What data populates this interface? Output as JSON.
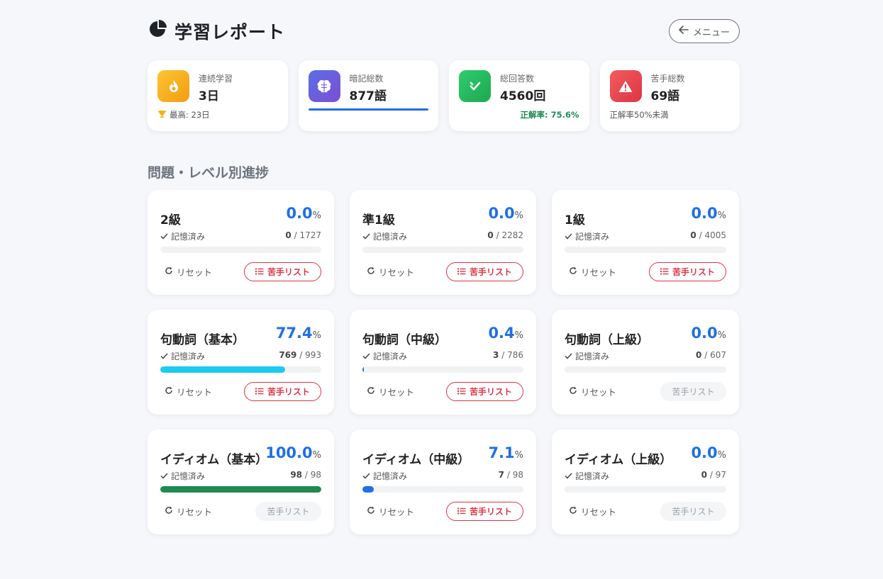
{
  "header": {
    "title": "学習レポート",
    "menu_label": "メニュー"
  },
  "stats": [
    {
      "label": "連続学習",
      "value": "3日",
      "sub": "最高: 23日",
      "icon": "flame-icon",
      "color": "#f7b322"
    },
    {
      "label": "暗記総数",
      "value": "877語",
      "icon": "brain-icon",
      "color": "#6f55d6"
    },
    {
      "label": "総回答数",
      "value": "4560回",
      "sub": "正解率: 75.6%",
      "icon": "check-icon",
      "color": "#22b35e"
    },
    {
      "label": "苦手総数",
      "value": "69語",
      "sub": "正解率50%未満",
      "icon": "warning-icon",
      "color": "#e84848"
    }
  ],
  "section_title": "問題・レベル別進捗",
  "common": {
    "memorized_label": "記憶済み",
    "reset_label": "リセット",
    "weak_label": "苦手リスト",
    "percent_sign": "%"
  },
  "levels": [
    {
      "name": "2級",
      "percent": "0.0",
      "done": "0",
      "total": "/ 1727",
      "progress": 0,
      "bar_color": "#1f6fe5",
      "weak_active": true
    },
    {
      "name": "準1級",
      "percent": "0.0",
      "done": "0",
      "total": "/ 2282",
      "progress": 0,
      "bar_color": "#1f6fe5",
      "weak_active": true
    },
    {
      "name": "1級",
      "percent": "0.0",
      "done": "0",
      "total": "/ 4005",
      "progress": 0,
      "bar_color": "#1f6fe5",
      "weak_active": true
    },
    {
      "name": "句動詞（基本）",
      "percent": "77.4",
      "done": "769",
      "total": "/ 993",
      "progress": 0.774,
      "bar_color": "#1ccaf0",
      "weak_active": true
    },
    {
      "name": "句動詞（中級）",
      "percent": "0.4",
      "done": "3",
      "total": "/ 786",
      "progress": 0.004,
      "bar_color": "#1f6fe5",
      "weak_active": true
    },
    {
      "name": "句動詞（上級）",
      "percent": "0.0",
      "done": "0",
      "total": "/ 607",
      "progress": 0,
      "bar_color": "#1f6fe5",
      "weak_active": false
    },
    {
      "name": "イディオム（基本）",
      "percent": "100.0",
      "done": "98",
      "total": "/ 98",
      "progress": 1.0,
      "bar_color": "#1e8a50",
      "weak_active": false
    },
    {
      "name": "イディオム（中級）",
      "percent": "7.1",
      "done": "7",
      "total": "/ 98",
      "progress": 0.071,
      "bar_color": "#1f6fe5",
      "weak_active": true
    },
    {
      "name": "イディオム（上級）",
      "percent": "0.0",
      "done": "0",
      "total": "/ 97",
      "progress": 0,
      "bar_color": "#1f6fe5",
      "weak_active": false
    }
  ]
}
